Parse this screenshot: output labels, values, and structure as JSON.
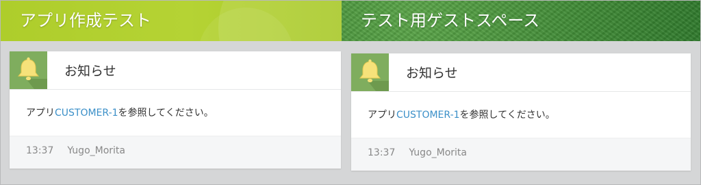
{
  "spaces": [
    {
      "banner_title": "アプリ作成テスト",
      "card": {
        "title": "お知らせ",
        "message_prefix": "アプリ",
        "message_link": "CUSTOMER-1",
        "message_suffix": "を参照してください。",
        "time": "13:37",
        "user": "Yugo_Morita"
      }
    },
    {
      "banner_title": "テスト用ゲストスペース",
      "card": {
        "title": "お知らせ",
        "message_prefix": "アプリ",
        "message_link": "CUSTOMER-1",
        "message_suffix": "を参照してください。",
        "time": "13:37",
        "user": "Yugo_Morita"
      }
    }
  ],
  "icons": {
    "notice": "bell-icon"
  },
  "colors": {
    "banner_left": "#aecd2b",
    "banner_right": "#3f8a35",
    "icon_bg": "#7fad5e",
    "bell": "#f6e27a",
    "link": "#3a8fc8"
  }
}
